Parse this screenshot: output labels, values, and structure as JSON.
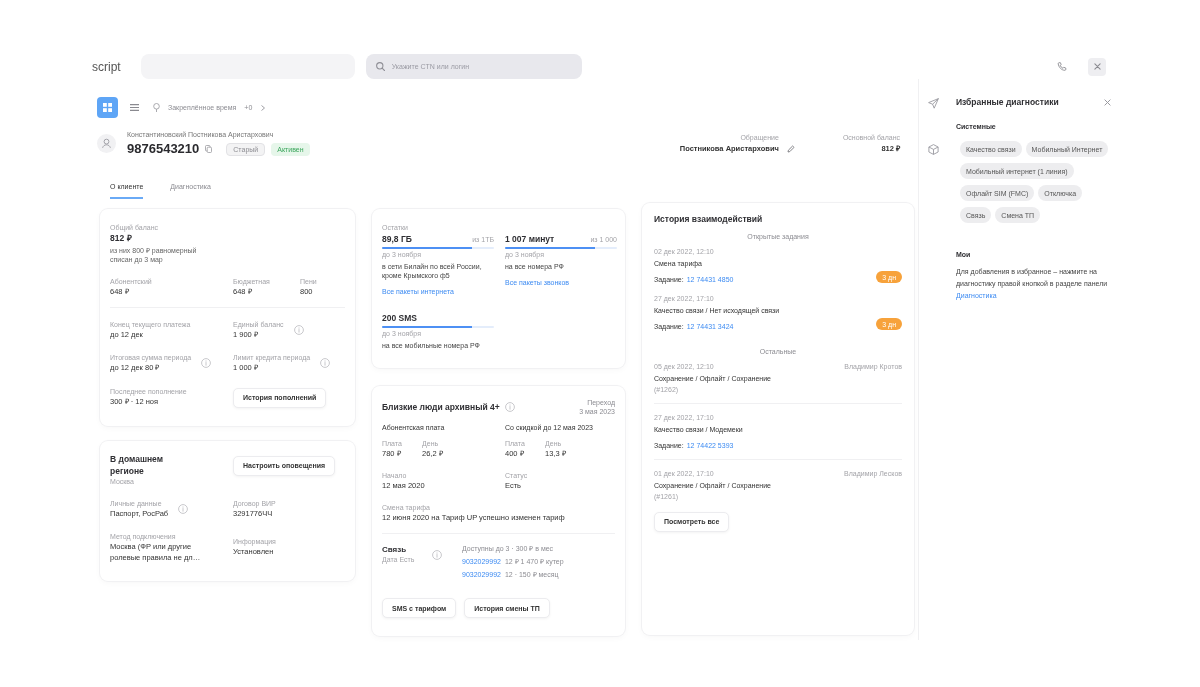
{
  "top_bar": {
    "logo": "script",
    "search": {
      "placeholder": "Укажите CTN или логин"
    }
  },
  "toolbar": {
    "reminder": "Закреплённое время",
    "counter": "+0"
  },
  "client": {
    "full_name": "Константиновский Постникова Аристархович",
    "phone": "9876543210",
    "tags": [
      {
        "label": "Старый",
        "kind": "neutral"
      },
      {
        "label": "Активен",
        "kind": "success"
      }
    ],
    "contact": {
      "label": "Обращение",
      "value": "Постникова Аристархович"
    },
    "balance": {
      "label": "Основной баланс",
      "value": "812 ₽"
    }
  },
  "tabs": [
    {
      "label": "О клиенте",
      "selected": true
    },
    {
      "label": "Диагностика",
      "selected": false
    }
  ],
  "balance_card": {
    "total": {
      "label": "Общий баланс",
      "value": "812 ₽",
      "note": "из них 800 ₽ равномерный списан до 3 мар"
    },
    "breakdown": [
      {
        "label": "Абонентский",
        "value": "648 ₽"
      },
      {
        "label": "Бюджетная",
        "value": "648 ₽"
      },
      {
        "label": "Пени",
        "value": "800"
      }
    ],
    "details": [
      {
        "label": "Конец текущего платежа",
        "value": "до 12 дек",
        "info": false
      },
      {
        "label": "Единый баланс",
        "value": "1 900 ₽",
        "info": true
      },
      {
        "label": "Итоговая сумма периода",
        "value": "до 12 дек 80 ₽",
        "info": true
      },
      {
        "label": "Лимит кредита периода",
        "value": "1 000 ₽",
        "info": true
      }
    ],
    "last_topup": {
      "label": "Последнее пополнение",
      "value": "300 ₽ · 12 ноя"
    },
    "history_button": "История пополнений"
  },
  "region_card": {
    "title": "В домашнем регионе",
    "subtitle": "Москва",
    "button": "Настроить оповещения",
    "fields": [
      {
        "label": "Личные данные",
        "value": "Паспорт, РосРаб",
        "info": true
      },
      {
        "label": "Договор ВИР",
        "value": "3291776ЧЧ",
        "info": false
      },
      {
        "label": "Метод подключения",
        "value": "Москва (ФР или другие ролевые правила не дл…",
        "info": false
      },
      {
        "label": "Информация",
        "value": "Установлен",
        "info": false
      }
    ]
  },
  "remains": {
    "label": "Остатки",
    "packages": [
      {
        "amount": "89,8 ГБ",
        "total": "из 1ТБ",
        "level": 0.8,
        "until": "до 3 ноября",
        "description": "в сети Билайн по всей России, кроме Крымского ф5",
        "link": "Все пакеты интернета"
      },
      {
        "amount": "1 007 минут",
        "total": "из 1 000",
        "level": 0.8,
        "until": "до 3 ноября",
        "description": "на все номера РФ",
        "link": "Все пакеты звонков"
      },
      {
        "amount": "200 SMS",
        "level": 0.8,
        "until": "до 3 ноября",
        "description": "на все мобильные номера РФ"
      }
    ]
  },
  "tariff": {
    "title": "Близкие люди архивный 4+",
    "transition_label": "Переход",
    "transition_date": "3 мая 2023",
    "fees": [
      {
        "title": "Абонентская плата",
        "items": [
          {
            "label": "Плата",
            "value": "780 ₽"
          },
          {
            "label": "День",
            "value": "26,2 ₽"
          }
        ]
      },
      {
        "title": "Со скидкой до 12 мая 2023",
        "items": [
          {
            "label": "Плата",
            "value": "400 ₽"
          },
          {
            "label": "День",
            "value": "13,3 ₽"
          }
        ]
      }
    ],
    "facts": [
      {
        "label": "Начало",
        "value": "12 мая 2020"
      },
      {
        "label": "Статус",
        "value": "Есть"
      }
    ],
    "change": {
      "label": "Смена тарифа",
      "value": "12 июня 2020 на Тариф UP успешно изменен тариф"
    },
    "connection": {
      "title": "Связь",
      "subtitle": "Дата Есть",
      "note": "Доступны до 3 · 300 ₽ в мес",
      "numbers": [
        {
          "number": "9032029992",
          "detail": "12 ₽ 1 470 ₽ кутер"
        },
        {
          "number": "9032029992",
          "detail": "12 · 150 ₽ месяц"
        }
      ]
    },
    "buttons": [
      "SMS с тарифом",
      "История смены ТП"
    ]
  },
  "history": {
    "title": "История взаимодействий",
    "groups": [
      {
        "heading": "Открытые задания",
        "entries": [
          {
            "date": "02 дек 2022, 12:10",
            "topic": "Смена тарифа",
            "task_label": "Задание:",
            "task": "12 74431 4850",
            "badge": "3 дн"
          },
          {
            "date": "27 дек 2022, 17:10",
            "topic": "Качество связи / Нет исходящей связи",
            "task_label": "Задание:",
            "task": "12 74431 3424",
            "badge": "3 дн"
          }
        ]
      },
      {
        "heading": "Остальные",
        "entries": [
          {
            "date": "05 дек 2022, 12:10",
            "author": "Владимир Кротов",
            "topic": "Сохранение / Офлайт / Сохранение",
            "code": "(#1262)"
          },
          {
            "date": "27 дек 2022, 17:10",
            "topic": "Качество связи / Модемеки",
            "task_label": "Задание:",
            "task": "12 74422 5393"
          },
          {
            "date": "01 дек 2022, 17:10",
            "author": "Владимир Лесков",
            "topic": "Сохранение / Офлайт / Сохранение",
            "code": "(#1261)"
          }
        ]
      }
    ],
    "button": "Посмотреть все"
  },
  "favorites": {
    "title": "Избранные диагностики",
    "system": {
      "heading": "Системные",
      "chip_rows": [
        [
          "Качество связи",
          "Мобильный Интернет"
        ],
        [
          "Мобильный интернет (1 линия)"
        ],
        [
          "Офлайт SIM (FMC)",
          "Отключка"
        ],
        [
          "Связь",
          "Смена ТП"
        ]
      ]
    },
    "mine": {
      "heading": "Мои",
      "hint": "Для добавления в избранное – нажмите на диагностику правой кнопкой в разделе панели",
      "link": "Диагностика"
    }
  }
}
